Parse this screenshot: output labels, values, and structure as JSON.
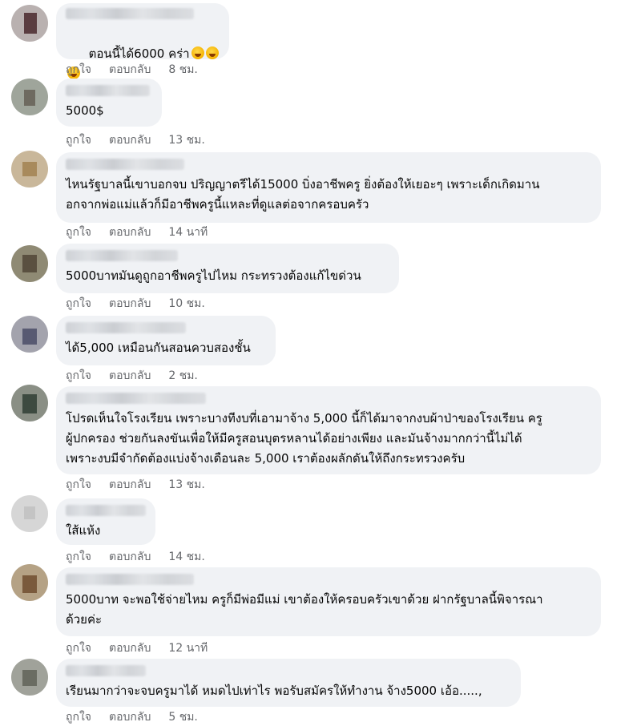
{
  "actions": {
    "like": "ถูกใจ",
    "reply": "ตอบกลับ"
  },
  "comments": [
    {
      "text": "ตอนนี้ได้6000 คร่า",
      "emoji": [
        "rofl-emoji",
        "rofl-emoji",
        "rofl-emoji"
      ],
      "time": "8 ชม."
    },
    {
      "text": "5000$",
      "time": "13 ชม."
    },
    {
      "text": "ไหนรัฐบาลนี้เขาบอกจบ ปริญญาตรีได้15000 บิ่งอาชีพครู ยิ่งต้องให้เยอะๆ เพราะเด็กเกิดมาน\nอกจากพ่อแม่แล้วก็มีอาชีพครูนี้แหละที่ดูแลต่อจากครอบครัว",
      "time": "14 นาที"
    },
    {
      "text": "5000บาทมันดูถูกอาชีพครูไปไหม กระทรวงต้องแก้ไขด่วน",
      "time": "10 ชม."
    },
    {
      "text": "ได้5,000 เหมือนกันสอนควบสองชั้น",
      "time": "2 ชม."
    },
    {
      "text": "โปรดเห็นใจโรงเรียน เพราะบางทีงบที่เอามาจ้าง 5,000 นี้ก็ได้มาจากงบผ้าป่าของโรงเรียน ครู\nผู้ปกครอง ช่วยกันลงขันเพื่อให้มีครูสอนบุตรหลานได้อย่างเพียง และมันจ้างมากกว่านี้ไม่ได้\nเพราะงบมีจำกัดต้องแบ่งจ้างเดือนละ 5,000 เราต้องผลักดันให้ถึงกระทรวงครับ",
      "time": "13 ชม."
    },
    {
      "text": "ใส้แห้ง",
      "time": "14 ชม."
    },
    {
      "text": "5000บาท จะพอใช้จ่ายไหม ครูก็มีพ่อมีแม่ เขาต้องให้ครอบครัวเขาด้วย ฝากรัฐบาลนี้พิจารณา\nด้วยค่ะ",
      "time": "12 นาที"
    },
    {
      "text": "เรียนมากว่าจะจบครูมาได้ หมดไปเท่าไร พอรับสมัครให้ทำงาน จ้าง5000 เอ้อ.....,",
      "time": "5 ชม."
    }
  ],
  "colors": {
    "bubble": "#f0f2f5",
    "meta": "#65676b",
    "text": "#050505"
  }
}
